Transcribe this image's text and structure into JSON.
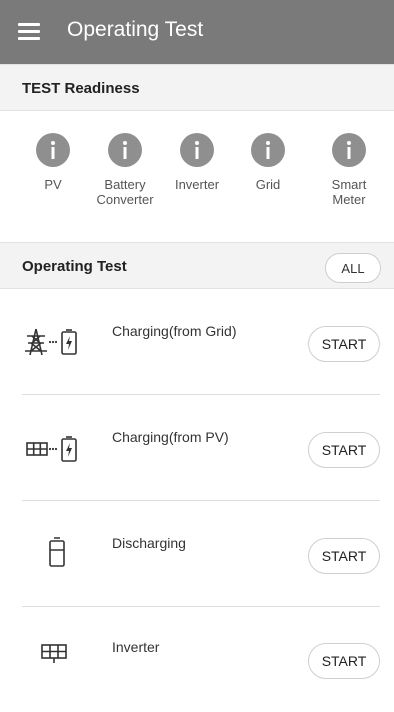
{
  "app_bar": {
    "title": "Operating Test",
    "menu_icon": "hamburger-menu-icon",
    "background": "#7a7a7a"
  },
  "readiness": {
    "header": "TEST Readiness",
    "status_icon": "info-icon",
    "status_color": "#8f8f8f",
    "items": [
      {
        "label": "PV"
      },
      {
        "label": "Battery\nConverter"
      },
      {
        "label": "Inverter"
      },
      {
        "label": "Grid"
      },
      {
        "label": "Smart\nMeter"
      }
    ]
  },
  "operating_test": {
    "header": "Operating Test",
    "all_label": "ALL",
    "tests": [
      {
        "label": "Charging(from Grid)",
        "icon": "grid-to-battery-icon",
        "button": "START"
      },
      {
        "label": "Charging(from PV)",
        "icon": "pv-to-battery-icon",
        "button": "START"
      },
      {
        "label": "Discharging",
        "icon": "battery-icon",
        "button": "START"
      },
      {
        "label": "Inverter",
        "icon": "inverter-icon",
        "button": "START"
      }
    ]
  }
}
